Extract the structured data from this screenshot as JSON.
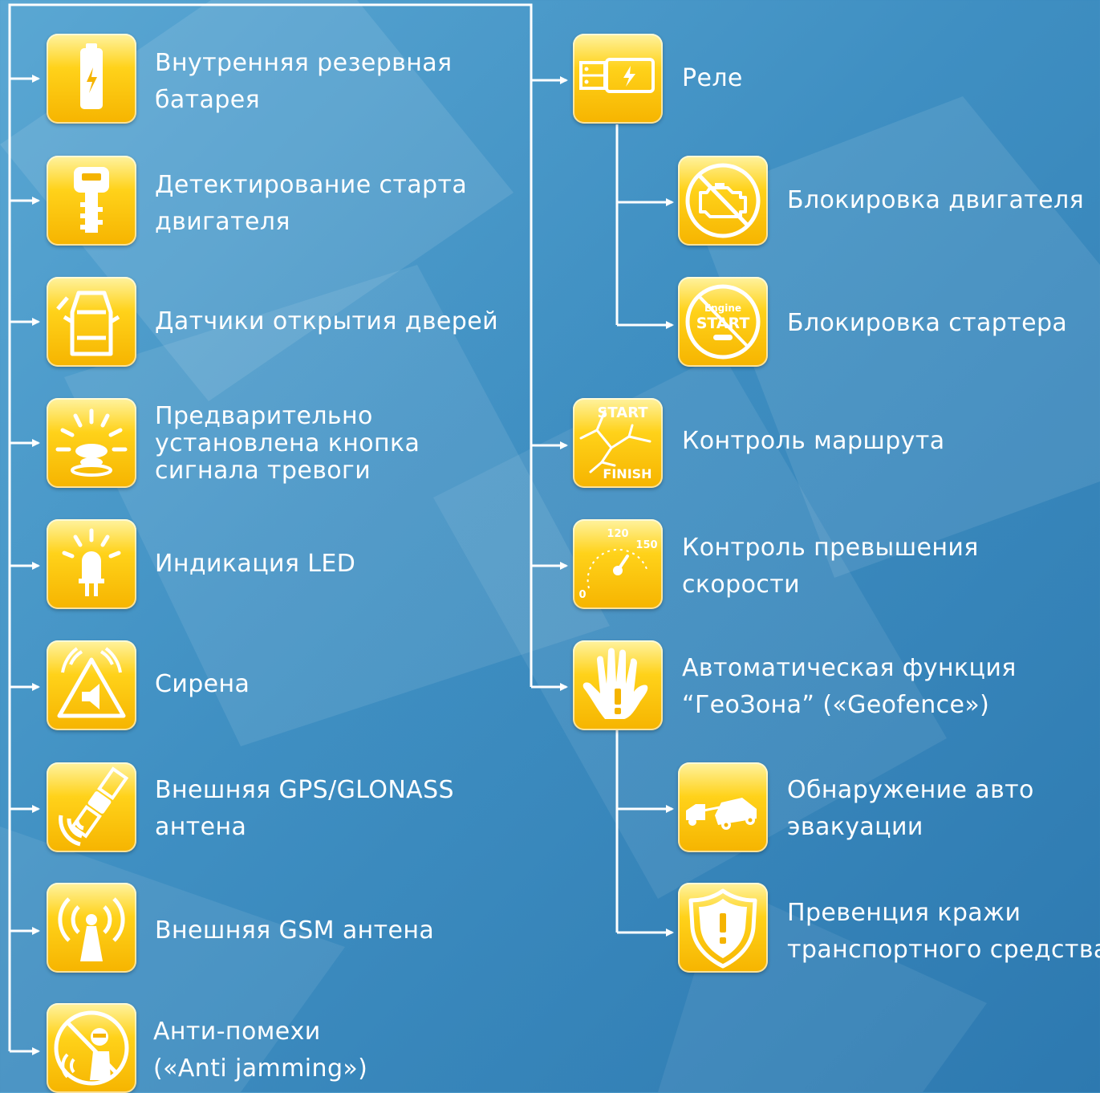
{
  "left_items": [
    {
      "icon": "battery-icon",
      "lines": [
        "Внутренняя резервная",
        "батарея"
      ]
    },
    {
      "icon": "key-icon",
      "lines": [
        "Детектирование старта",
        "двигателя"
      ]
    },
    {
      "icon": "car-door-icon",
      "lines": [
        "Датчики открытия дверей"
      ]
    },
    {
      "icon": "panic-button-icon",
      "lines": [
        "Предварительно",
        "установлена кнопка",
        "сигнала тревоги"
      ]
    },
    {
      "icon": "led-icon",
      "lines": [
        "Индикация LED"
      ]
    },
    {
      "icon": "siren-icon",
      "lines": [
        "Сирена"
      ]
    },
    {
      "icon": "satellite-icon",
      "lines": [
        "Внешняя GPS/GLONASS",
        "антена"
      ]
    },
    {
      "icon": "gsm-antenna-icon",
      "lines": [
        "Внешняя GSM антена"
      ]
    },
    {
      "icon": "anti-jamming-icon",
      "lines": [
        "Анти-помехи",
        "(«Anti jamming»)"
      ]
    }
  ],
  "right_items": [
    {
      "icon": "relay-icon",
      "lines": [
        "Реле"
      ]
    },
    {
      "icon": "engine-block-icon",
      "lines": [
        "Блокировка двигателя"
      ]
    },
    {
      "icon": "starter-block-icon",
      "lines": [
        "Блокировка стартера"
      ],
      "icon_text": [
        "Engine",
        "START"
      ]
    },
    {
      "icon": "route-icon",
      "lines": [
        "Контроль маршрута"
      ],
      "icon_text": [
        "START",
        "FINISH"
      ]
    },
    {
      "icon": "speedometer-icon",
      "lines": [
        "Контроль превышения",
        "скорости"
      ],
      "icon_text": [
        "120",
        "150",
        "0"
      ]
    },
    {
      "icon": "hand-icon",
      "lines": [
        "Автоматическая функция",
        "“ГеоЗона” («Geofence»)"
      ]
    },
    {
      "icon": "tow-truck-icon",
      "lines": [
        "Обнаружение авто",
        "эвакуации"
      ]
    },
    {
      "icon": "shield-icon",
      "lines": [
        "Превенция кражи",
        "транспортного средства"
      ]
    }
  ]
}
